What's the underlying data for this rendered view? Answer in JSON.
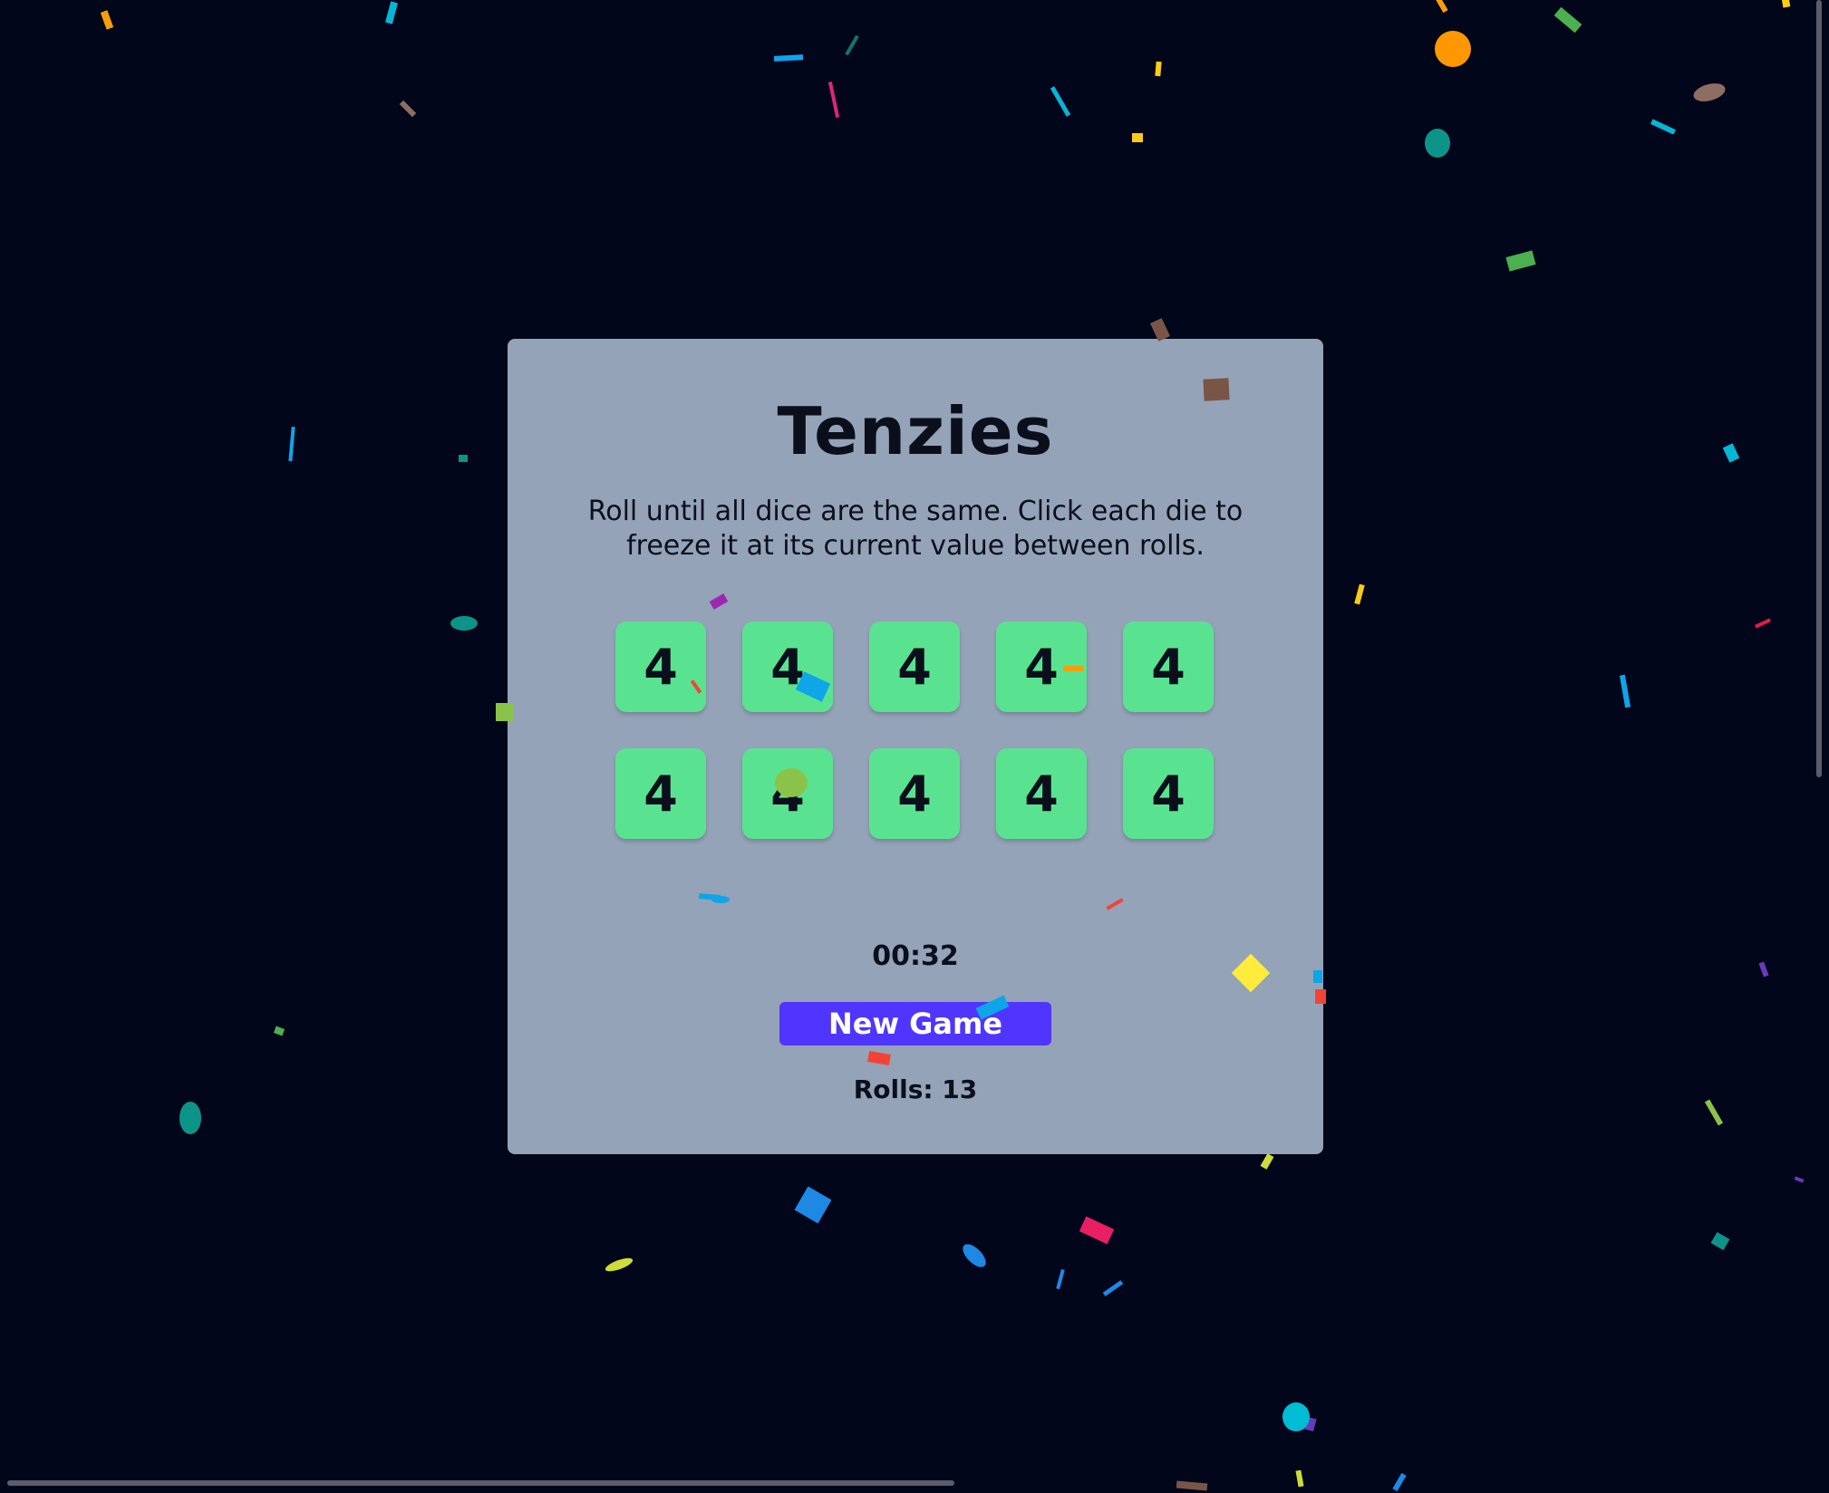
{
  "game": {
    "title": "Tenzies",
    "instructions": "Roll until all dice are the same. Click each die to freeze it at its current value between rolls.",
    "dice": [
      {
        "value": "4",
        "held": true
      },
      {
        "value": "4",
        "held": true
      },
      {
        "value": "4",
        "held": true
      },
      {
        "value": "4",
        "held": true
      },
      {
        "value": "4",
        "held": true
      },
      {
        "value": "4",
        "held": true
      },
      {
        "value": "4",
        "held": true
      },
      {
        "value": "4",
        "held": true
      },
      {
        "value": "4",
        "held": true
      },
      {
        "value": "4",
        "held": true
      }
    ],
    "timer": "00:32",
    "new_game_label": "New Game",
    "rolls_label": "Rolls: 13"
  },
  "colors": {
    "background": "#02061a",
    "panel": "#94a3b8",
    "die_held": "#59e391",
    "button": "#5035ff",
    "text": "#0b0f1c"
  }
}
